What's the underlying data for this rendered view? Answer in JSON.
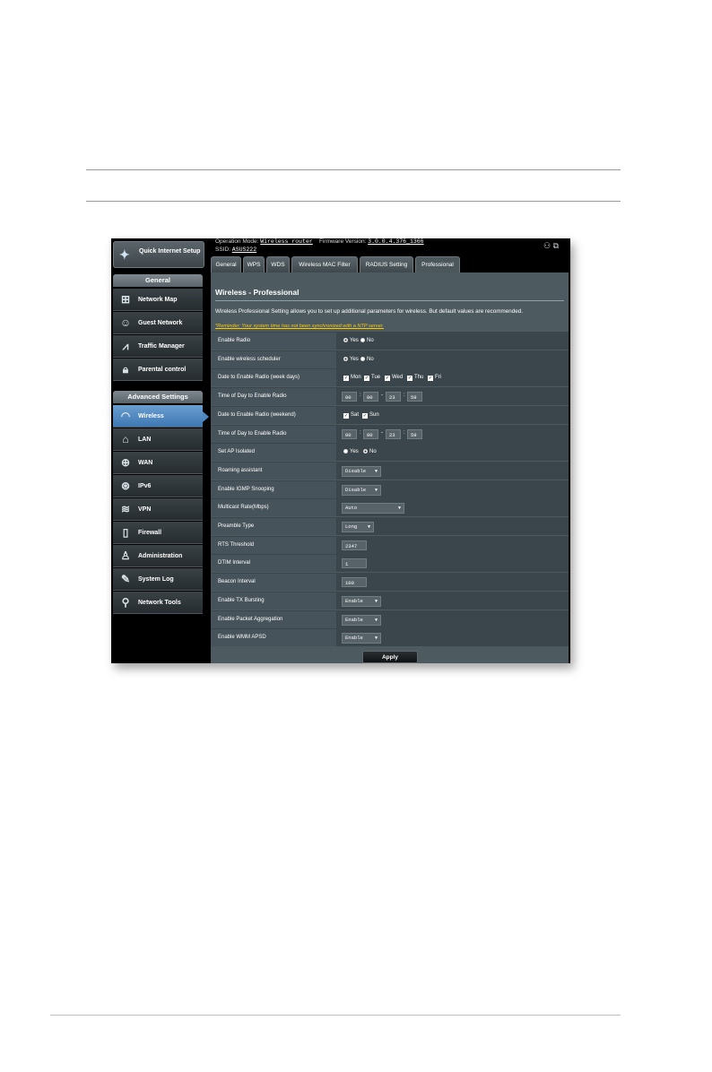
{
  "top": {
    "operation_mode_label": "Operation Mode:",
    "operation_mode_value": "Wireless router",
    "firmware_label": "Firmware Version:",
    "firmware_value": "3.0.0.4.376_1366",
    "ssid_label": "SSID:",
    "ssid_value": "ASUS222"
  },
  "sidebar": {
    "qis_label": "Quick Internet Setup",
    "general_header": "General",
    "general_items": [
      {
        "label": "Network Map",
        "icon": "network-map-icon"
      },
      {
        "label": "Guest Network",
        "icon": "guest-network-icon"
      },
      {
        "label": "Traffic Manager",
        "icon": "traffic-manager-icon"
      },
      {
        "label": "Parental control",
        "icon": "lock-icon"
      }
    ],
    "advanced_header": "Advanced Settings",
    "advanced_items": [
      {
        "label": "Wireless",
        "icon": "wifi-icon"
      },
      {
        "label": "LAN",
        "icon": "home-icon"
      },
      {
        "label": "WAN",
        "icon": "globe-icon"
      },
      {
        "label": "IPv6",
        "icon": "ipv6-globe-icon"
      },
      {
        "label": "VPN",
        "icon": "vpn-icon"
      },
      {
        "label": "Firewall",
        "icon": "shield-icon"
      },
      {
        "label": "Administration",
        "icon": "user-icon"
      },
      {
        "label": "System Log",
        "icon": "edit-icon"
      },
      {
        "label": "Network Tools",
        "icon": "search-icon"
      }
    ]
  },
  "tabs": [
    "General",
    "WPS",
    "WDS",
    "Wireless MAC Filter",
    "RADIUS Setting",
    "Professional"
  ],
  "panel": {
    "title": "Wireless - Professional",
    "description": "Wireless Professional Setting allows you to set up additional parameters for wireless. But default values are recommended.",
    "reminder": "*Reminder: Your system time has not been synchronized with a NTP server."
  },
  "settings": {
    "enable_radio": {
      "label": "Enable Radio",
      "opt_yes": "Yes",
      "opt_no": "No"
    },
    "enable_scheduler": {
      "label": "Enable wireless scheduler",
      "opt_yes": "Yes",
      "opt_no": "No"
    },
    "weekdays": {
      "label": "Date to Enable Radio (week days)",
      "mon": "Mon",
      "tue": "Tue",
      "wed": "Wed",
      "thu": "Thu",
      "fri": "Fri"
    },
    "weekday_time": {
      "label": "Time of Day to Enable Radio",
      "h1": "00",
      "m1": "00",
      "h2": "23",
      "m2": "59"
    },
    "weekend": {
      "label": "Date to Enable Radio (weekend)",
      "sat": "Sat",
      "sun": "Sun"
    },
    "weekend_time": {
      "label": "Time of Day to Enable Radio",
      "h1": "00",
      "m1": "00",
      "h2": "23",
      "m2": "59"
    },
    "ap_isolated": {
      "label": "Set AP Isolated",
      "opt_yes": "Yes",
      "opt_no": "No"
    },
    "roaming": {
      "label": "Roaming assistant",
      "value": "Disable"
    },
    "igmp": {
      "label": "Enable IGMP Snooping",
      "value": "Disable"
    },
    "multicast": {
      "label": "Multicast Rate(Mbps)",
      "value": "Auto"
    },
    "preamble": {
      "label": "Preamble Type",
      "value": "Long"
    },
    "rts": {
      "label": "RTS Threshold",
      "value": "2347"
    },
    "dtim": {
      "label": "DTIM Interval",
      "value": "1"
    },
    "beacon": {
      "label": "Beacon Interval",
      "value": "100"
    },
    "tx_bursting": {
      "label": "Enable TX Bursting",
      "value": "Enable"
    },
    "packet_aggregation": {
      "label": "Enable Packet Aggregation",
      "value": "Enable"
    },
    "wmm_apsd": {
      "label": "Enable WMM APSD",
      "value": "Enable"
    }
  },
  "apply_label": "Apply"
}
